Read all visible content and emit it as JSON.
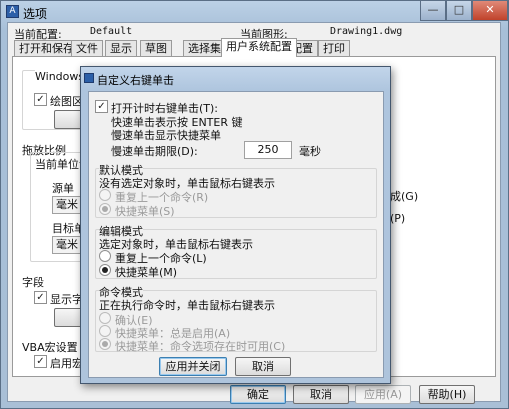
{
  "window": {
    "title": "选项",
    "icon": "app-icon",
    "current_config_label": "当前配置:",
    "current_config_value": "Default",
    "current_drawing_label": "当前图形:",
    "current_drawing_value": "Drawing1.dwg",
    "caption_minimize": "—",
    "caption_maximize": "□",
    "caption_close": "✕"
  },
  "tabs": [
    {
      "label": "打开和保存"
    },
    {
      "label": "文件"
    },
    {
      "label": "显示"
    },
    {
      "label": "草图"
    },
    {
      "label": "选择集"
    },
    {
      "label": "用户系统配置",
      "active": true
    },
    {
      "label": "配置"
    },
    {
      "label": "打印"
    }
  ],
  "background_panel": {
    "windows_group": "Windows标",
    "draw_area_check": "绘图区",
    "drag_scale_group": "拖放比例",
    "current_unit": "当前单位设",
    "source_unit": "源单",
    "source_unit_value": "毫米",
    "target_unit": "目标单",
    "target_unit_value": "毫米",
    "fields_group": "字段",
    "show_check": "显示字",
    "vba_group": "VBA宏设置",
    "enable_check": "启用宏",
    "right_text_1": "成(G)",
    "right_text_2": "(P)"
  },
  "footer_buttons": {
    "ok": "确定",
    "cancel": "取消",
    "apply": "应用(A)",
    "help": "帮助(H)"
  },
  "dialog": {
    "title": "自定义右键单击",
    "timed_right_click": "打开计时右键单击(T):",
    "quick_click_line1": "快速单击表示按 ENTER 键",
    "quick_click_line2": "慢速单击显示快捷菜单",
    "duration_label": "慢速单击期限(D):",
    "duration_value": "250",
    "duration_unit": "毫秒",
    "default_mode": {
      "title": "默认模式",
      "desc": "没有选定对象时，单击鼠标右键表示",
      "option_repeat": "重复上一个命令(R)",
      "option_menu": "快捷菜单(S)"
    },
    "edit_mode": {
      "title": "编辑模式",
      "desc": "选定对象时，单击鼠标右键表示",
      "option_repeat": "重复上一个命令(L)",
      "option_menu": "快捷菜单(M)"
    },
    "command_mode": {
      "title": "命令模式",
      "desc": "正在执行命令时，单击鼠标右键表示",
      "option_confirm": "确认(E)",
      "option_menu_always": "快捷菜单：总是启用(A)",
      "option_menu_options": "快捷菜单：命令选项存在时可用(C)"
    },
    "apply_close": "应用并关闭",
    "cancel": "取消"
  }
}
